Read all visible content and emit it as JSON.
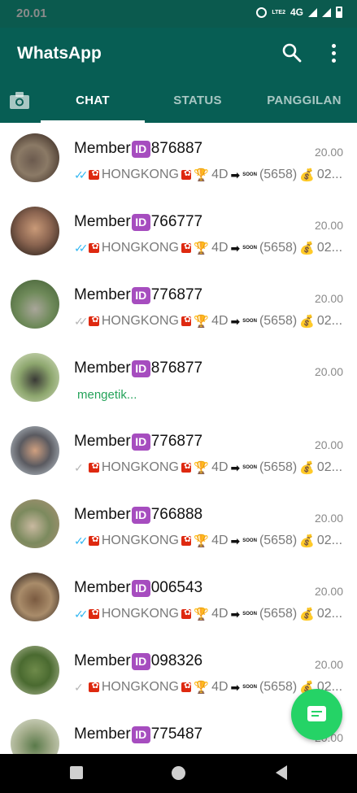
{
  "status_bar": {
    "time": "20.01",
    "network": "4G",
    "volte": "LTE2"
  },
  "app": {
    "title": "WhatsApp"
  },
  "tabs": [
    {
      "label": "CHAT",
      "selected": true
    },
    {
      "label": "STATUS",
      "selected": false
    },
    {
      "label": "PANGGILAN",
      "selected": false
    }
  ],
  "colors": {
    "header": "#075e54",
    "accent": "#25d366",
    "read_tick": "#34b7f1",
    "typing": "#25a35a"
  },
  "chats": [
    {
      "name_prefix": "Member",
      "badge": "ID",
      "name_suffix": "876887",
      "time": "20.00",
      "tick": "read",
      "preview": {
        "hk": "HONGKONG",
        "d": "4D",
        "num": "(5658)",
        "end": "02...",
        "soon": "SOON"
      },
      "typing": ""
    },
    {
      "name_prefix": "Member",
      "badge": "ID",
      "name_suffix": "766777",
      "time": "20.00",
      "tick": "read",
      "preview": {
        "hk": "HONGKONG",
        "d": "4D",
        "num": "(5658)",
        "end": "02...",
        "soon": "SOON"
      },
      "typing": ""
    },
    {
      "name_prefix": "Member",
      "badge": "ID",
      "name_suffix": "776877",
      "time": "20.00",
      "tick": "grey2",
      "preview": {
        "hk": "HONGKONG",
        "d": "4D",
        "num": "(5658)",
        "end": "02...",
        "soon": "SOON"
      },
      "typing": ""
    },
    {
      "name_prefix": "Member",
      "badge": "ID",
      "name_suffix": "876877",
      "time": "20.00",
      "tick": "none",
      "preview": null,
      "typing": "mengetik..."
    },
    {
      "name_prefix": "Member",
      "badge": "ID",
      "name_suffix": "776877",
      "time": "20.00",
      "tick": "grey1",
      "preview": {
        "hk": "HONGKONG",
        "d": "4D",
        "num": "(5658)",
        "end": "02...",
        "soon": "SOON"
      },
      "typing": ""
    },
    {
      "name_prefix": "Member",
      "badge": "ID",
      "name_suffix": "766888",
      "time": "20.00",
      "tick": "read",
      "preview": {
        "hk": "HONGKONG",
        "d": "4D",
        "num": "(5658)",
        "end": "02...",
        "soon": "SOON"
      },
      "typing": ""
    },
    {
      "name_prefix": "Member",
      "badge": "ID",
      "name_suffix": "006543",
      "time": "20.00",
      "tick": "read",
      "preview": {
        "hk": "HONGKONG",
        "d": "4D",
        "num": "(5658)",
        "end": "02...",
        "soon": "SOON"
      },
      "typing": ""
    },
    {
      "name_prefix": "Member",
      "badge": "ID",
      "name_suffix": "098326",
      "time": "20.00",
      "tick": "grey1",
      "preview": {
        "hk": "HONGKONG",
        "d": "4D",
        "num": "(5658)",
        "end": "02...",
        "soon": "SOON"
      },
      "typing": ""
    },
    {
      "name_prefix": "Member",
      "badge": "ID",
      "name_suffix": "775487",
      "time": "20.00",
      "tick": "none",
      "preview": null,
      "typing": ""
    }
  ]
}
